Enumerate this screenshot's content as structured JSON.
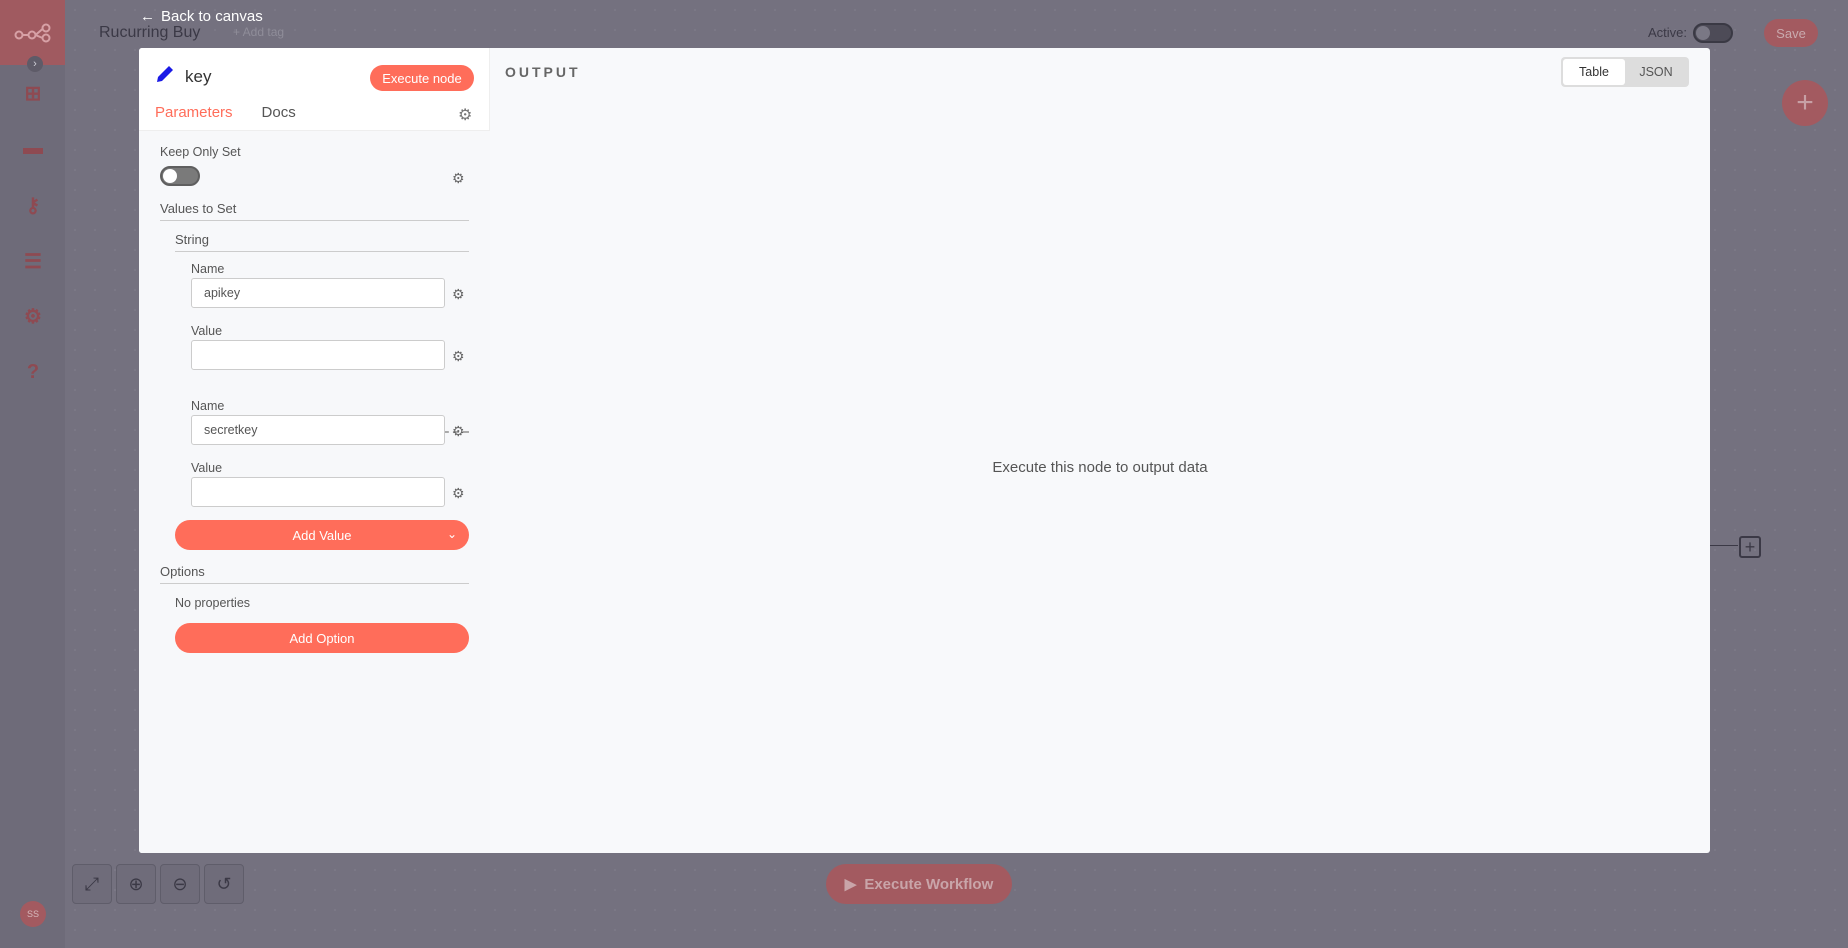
{
  "app": {
    "workflow_title": "Rucurring Buy",
    "add_tag": "+ Add tag",
    "active_label": "Active:",
    "save_label": "Save",
    "execute_workflow": "Execute Workflow",
    "user_initials": "SS",
    "back_label": "Back to canvas"
  },
  "node": {
    "name": "key",
    "execute_label": "Execute node",
    "tabs": [
      {
        "label": "Parameters",
        "active": true
      },
      {
        "label": "Docs",
        "active": false
      }
    ]
  },
  "params": {
    "keep_only_set_label": "Keep Only Set",
    "keep_only_set_value": false,
    "values_to_set_label": "Values to Set",
    "string_label": "String",
    "entries": [
      {
        "name_label": "Name",
        "name_value": "apikey",
        "value_label": "Value",
        "value_value": ""
      },
      {
        "name_label": "Name",
        "name_value": "secretkey",
        "value_label": "Value",
        "value_value": ""
      }
    ],
    "add_value_label": "Add Value",
    "options_label": "Options",
    "no_properties": "No properties",
    "add_option_label": "Add Option"
  },
  "output": {
    "title": "OUTPUT",
    "view_options": [
      "Table",
      "JSON"
    ],
    "selected_view": "Table",
    "empty_message": "Execute this node to output data"
  },
  "colors": {
    "accent": "#ff6d5a",
    "overlay": "#74717f"
  }
}
